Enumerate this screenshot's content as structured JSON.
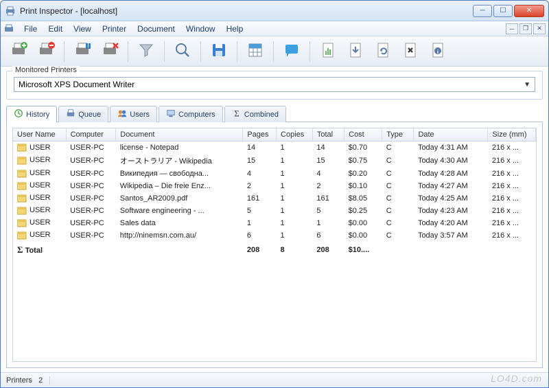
{
  "window": {
    "title": "Print Inspector - [localhost]"
  },
  "menu": {
    "items": [
      "File",
      "Edit",
      "View",
      "Printer",
      "Document",
      "Window",
      "Help"
    ]
  },
  "toolbar": {
    "buttons": [
      {
        "name": "printer-add-icon"
      },
      {
        "name": "printer-remove-icon"
      },
      {
        "sep": true
      },
      {
        "name": "printer-pause-icon"
      },
      {
        "name": "printer-delete-icon"
      },
      {
        "sep": true
      },
      {
        "name": "filter-icon"
      },
      {
        "sep": true
      },
      {
        "name": "search-icon"
      },
      {
        "sep": true
      },
      {
        "name": "save-icon"
      },
      {
        "sep": true
      },
      {
        "name": "table-icon"
      },
      {
        "sep": true
      },
      {
        "name": "chat-icon"
      },
      {
        "sep": true
      },
      {
        "name": "report-icon"
      },
      {
        "name": "download-icon"
      },
      {
        "name": "refresh-icon"
      },
      {
        "name": "delete-icon"
      },
      {
        "name": "info-icon"
      }
    ]
  },
  "monitored": {
    "legend": "Monitored Printers",
    "selected": "Microsoft XPS Document Writer"
  },
  "tabs": [
    {
      "label": "History",
      "icon": "clock-icon",
      "active": true
    },
    {
      "label": "Queue",
      "icon": "queue-icon",
      "active": false
    },
    {
      "label": "Users",
      "icon": "users-icon",
      "active": false
    },
    {
      "label": "Computers",
      "icon": "computer-icon",
      "active": false
    },
    {
      "label": "Combined",
      "icon": "sigma-icon",
      "active": false
    }
  ],
  "table": {
    "columns": [
      "User Name",
      "Computer",
      "Document",
      "Pages",
      "Copies",
      "Total",
      "Cost",
      "Type",
      "Date",
      "Size (mm)"
    ],
    "rows": [
      {
        "user": "USER",
        "computer": "USER-PC",
        "doc": "license - Notepad",
        "pages": "14",
        "copies": "1",
        "total": "14",
        "cost": "$0.70",
        "type": "C",
        "date": "Today 4:31 AM",
        "size": "216 x ..."
      },
      {
        "user": "USER",
        "computer": "USER-PC",
        "doc": "オーストラリア - Wikipedia",
        "pages": "15",
        "copies": "1",
        "total": "15",
        "cost": "$0.75",
        "type": "C",
        "date": "Today 4:30 AM",
        "size": "216 x ..."
      },
      {
        "user": "USER",
        "computer": "USER-PC",
        "doc": "Википедия — свободна...",
        "pages": "4",
        "copies": "1",
        "total": "4",
        "cost": "$0.20",
        "type": "C",
        "date": "Today 4:28 AM",
        "size": "216 x ..."
      },
      {
        "user": "USER",
        "computer": "USER-PC",
        "doc": "Wikipedia – Die freie Enz...",
        "pages": "2",
        "copies": "1",
        "total": "2",
        "cost": "$0.10",
        "type": "C",
        "date": "Today 4:27 AM",
        "size": "216 x ..."
      },
      {
        "user": "USER",
        "computer": "USER-PC",
        "doc": "Santos_AR2009.pdf",
        "pages": "161",
        "copies": "1",
        "total": "161",
        "cost": "$8.05",
        "type": "C",
        "date": "Today 4:25 AM",
        "size": "216 x ..."
      },
      {
        "user": "USER",
        "computer": "USER-PC",
        "doc": "Software engineering - ...",
        "pages": "5",
        "copies": "1",
        "total": "5",
        "cost": "$0.25",
        "type": "C",
        "date": "Today 4:23 AM",
        "size": "216 x ..."
      },
      {
        "user": "USER",
        "computer": "USER-PC",
        "doc": "Sales data",
        "pages": "1",
        "copies": "1",
        "total": "1",
        "cost": "$0.00",
        "type": "C",
        "date": "Today 4:20 AM",
        "size": "216 x ..."
      },
      {
        "user": "USER",
        "computer": "USER-PC",
        "doc": "http://ninemsn.com.au/",
        "pages": "6",
        "copies": "1",
        "total": "6",
        "cost": "$0.00",
        "type": "C",
        "date": "Today 3:57 AM",
        "size": "216 x ..."
      }
    ],
    "total": {
      "label": "Total",
      "pages": "208",
      "copies": "8",
      "total": "208",
      "cost": "$10...."
    }
  },
  "status": {
    "label": "Printers",
    "count": "2"
  },
  "watermark": "LO4D.com"
}
